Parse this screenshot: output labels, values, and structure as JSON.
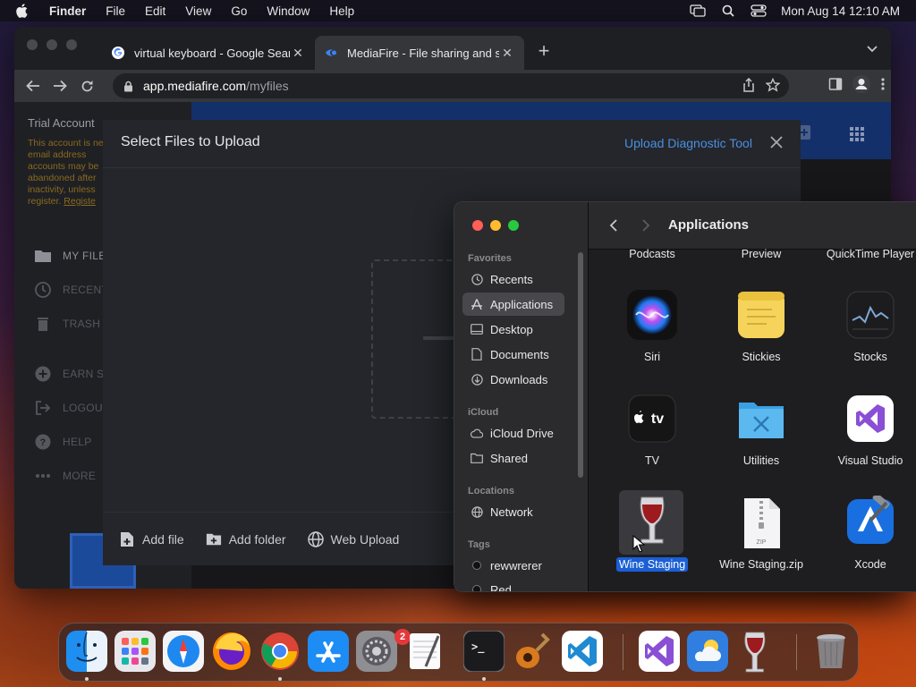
{
  "menubar": {
    "app_name": "Finder",
    "menus": [
      "File",
      "Edit",
      "View",
      "Go",
      "Window",
      "Help"
    ],
    "clock": "Mon Aug 14  12:10 AM"
  },
  "chrome": {
    "tabs": [
      {
        "title": "virtual keyboard - Google Sear",
        "favicon": "google-icon"
      },
      {
        "title": "MediaFire - File sharing and st",
        "favicon": "mediafire-icon"
      }
    ],
    "url_host": "app.mediafire.com",
    "url_path": "/myfiles"
  },
  "mediafire": {
    "trial_title": "Trial Account",
    "trial_text": "This account is ne an email address accounts may be abandoned after inactivity, unless register.",
    "trial_link": "Registe",
    "nav": [
      {
        "label": "MY FILE",
        "icon": "folder-icon"
      },
      {
        "label": "RECENT",
        "icon": "clock-icon"
      },
      {
        "label": "TRASH",
        "icon": "trash-icon"
      },
      {
        "label": "EARN S",
        "icon": "plus-circle-icon"
      },
      {
        "label": "LOGOUT",
        "icon": "logout-icon"
      },
      {
        "label": "HELP",
        "icon": "help-icon"
      },
      {
        "label": "MORE",
        "icon": "more-icon"
      }
    ],
    "modal": {
      "title": "Select Files to Upload",
      "diagnostic_link": "Upload Diagnostic Tool",
      "add_file": "Add file",
      "add_folder": "Add folder",
      "web_upload": "Web Upload"
    }
  },
  "finder": {
    "title": "Applications",
    "sections": {
      "favorites": "Favorites",
      "icloud": "iCloud",
      "locations": "Locations",
      "tags": "Tags"
    },
    "favorites": [
      "Recents",
      "Applications",
      "Desktop",
      "Documents",
      "Downloads"
    ],
    "icloud": [
      "iCloud Drive",
      "Shared"
    ],
    "locations": [
      "Network"
    ],
    "tags": [
      "rewwrerer",
      "Red"
    ],
    "top_row_labels": [
      "Podcasts",
      "Preview",
      "QuickTime Player"
    ],
    "apps": [
      {
        "name": "Siri",
        "icon": "siri-icon"
      },
      {
        "name": "Stickies",
        "icon": "stickies-icon"
      },
      {
        "name": "Stocks",
        "icon": "stocks-icon"
      },
      {
        "name": "TV",
        "icon": "tv-icon"
      },
      {
        "name": "Utilities",
        "icon": "utilities-folder-icon"
      },
      {
        "name": "Visual Studio",
        "icon": "visual-studio-icon"
      },
      {
        "name": "Wine Staging",
        "icon": "wine-icon",
        "selected": true
      },
      {
        "name": "Wine Staging.zip",
        "icon": "zip-icon"
      },
      {
        "name": "Xcode",
        "icon": "xcode-icon"
      }
    ],
    "tv_glyph": "tv",
    "zip_glyph": "ZIP"
  },
  "dock": {
    "items": [
      "finder-icon",
      "launchpad-icon",
      "safari-icon",
      "firefox-icon",
      "chrome-icon",
      "app-store-icon",
      "system-settings-icon",
      "textedit-icon",
      "terminal-icon",
      "garageband-icon",
      "vscode-icon",
      "visual-studio-icon",
      "weather-icon",
      "wine-icon",
      "trash-icon"
    ],
    "settings_badge": "2",
    "terminal_glyph": ">_"
  },
  "colors": {
    "accent_blue": "#1a5fd6",
    "mediafire_blue": "#14306b",
    "link_blue": "#4b8fe0",
    "trial_text": "#8a6a1e"
  }
}
